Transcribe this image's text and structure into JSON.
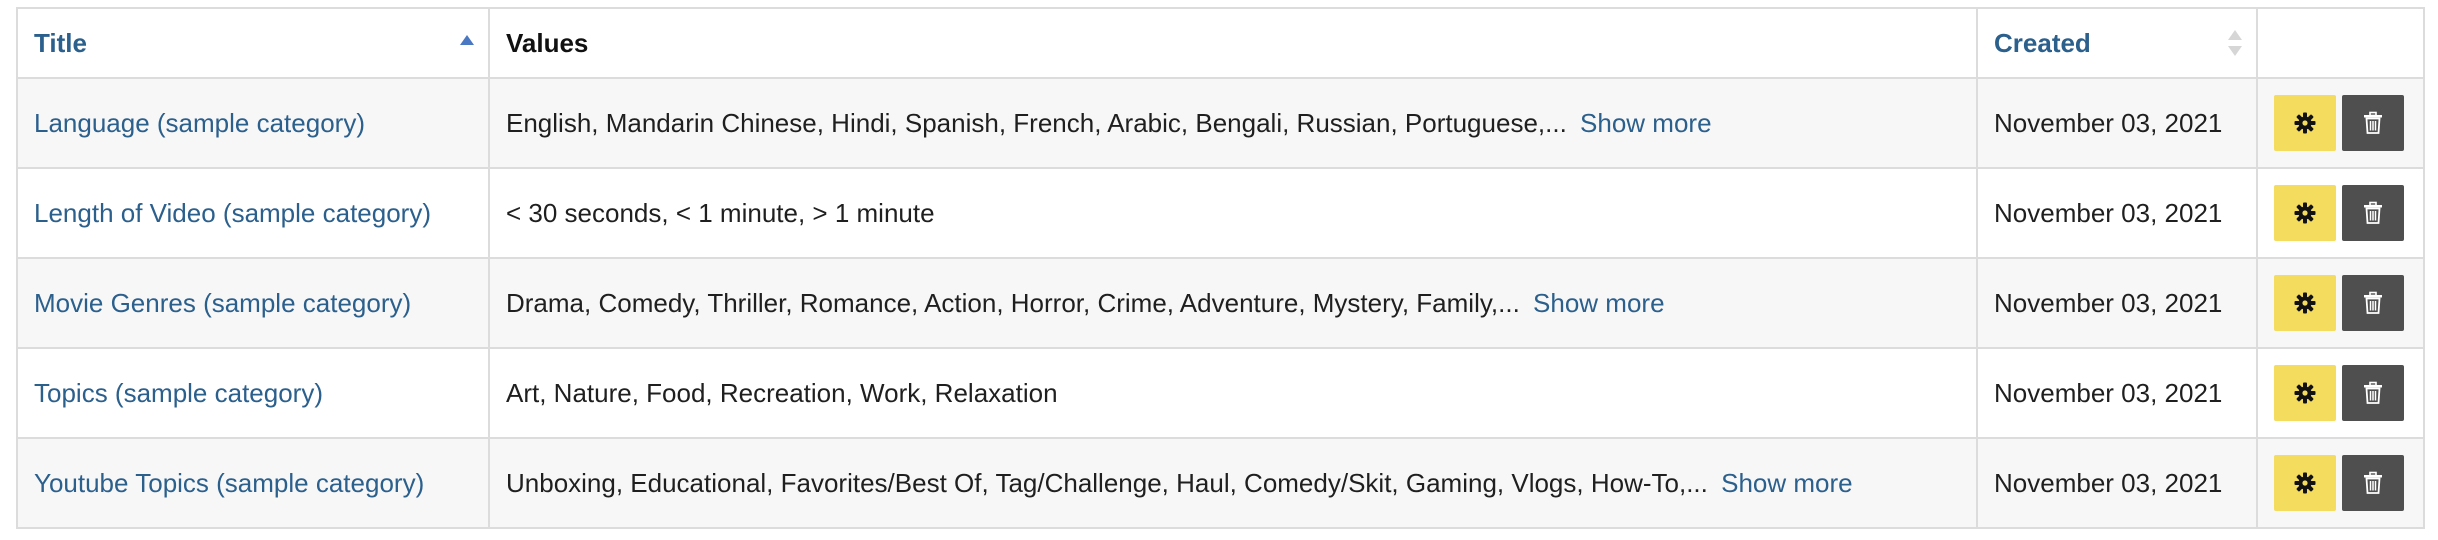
{
  "table": {
    "headers": {
      "title": "Title",
      "values": "Values",
      "created": "Created"
    },
    "sort": {
      "title": "ascending",
      "created": "unsorted"
    },
    "colors": {
      "link": "#2b5f8c",
      "settings_button": "#f3dc5e",
      "delete_button": "#4f4f4f"
    },
    "rows": [
      {
        "title": "Language (sample category)",
        "values": "English, Mandarin Chinese, Hindi, Spanish, French, Arabic, Bengali, Russian, Portuguese,...",
        "show_more": "Show more",
        "created": "November 03, 2021"
      },
      {
        "title": "Length of Video (sample category)",
        "values": "< 30 seconds, < 1 minute, > 1 minute",
        "show_more": "",
        "created": "November 03, 2021"
      },
      {
        "title": "Movie Genres (sample category)",
        "values": "Drama, Comedy, Thriller, Romance, Action, Horror, Crime, Adventure, Mystery, Family,...",
        "show_more": "Show more",
        "created": "November 03, 2021"
      },
      {
        "title": "Topics (sample category)",
        "values": "Art, Nature, Food, Recreation, Work, Relaxation",
        "show_more": "",
        "created": "November 03, 2021"
      },
      {
        "title": "Youtube Topics (sample category)",
        "values": "Unboxing, Educational, Favorites/Best Of, Tag/Challenge, Haul, Comedy/Skit, Gaming, Vlogs, How-To,...",
        "show_more": "Show more",
        "created": "November 03, 2021"
      }
    ],
    "row_actions": {
      "settings_icon": "gear-icon",
      "delete_icon": "trash-icon"
    }
  }
}
